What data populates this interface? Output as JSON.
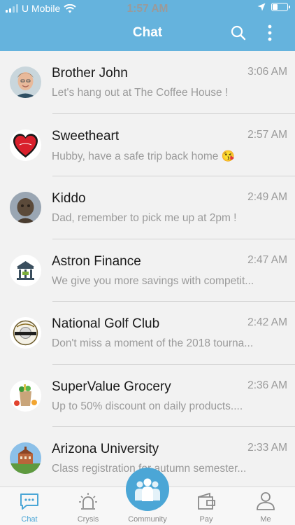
{
  "status": {
    "carrier": "U Mobile",
    "time": "1:57 AM"
  },
  "header": {
    "title": "Chat"
  },
  "chats": [
    {
      "name": "Brother John",
      "message": "Let's hang out at The Coffee House !",
      "time": "3:06 AM"
    },
    {
      "name": "Sweetheart",
      "message": "Hubby, have a safe trip back home 😘",
      "time": "2:57 AM"
    },
    {
      "name": "Kiddo",
      "message": "Dad, remember to pick me up at 2pm !",
      "time": "2:49 AM"
    },
    {
      "name": "Astron Finance",
      "message": "We give you more savings with competit...",
      "time": "2:47 AM"
    },
    {
      "name": "National Golf Club",
      "message": "Don't miss a moment of the 2018 tourna...",
      "time": "2:42 AM"
    },
    {
      "name": "SuperValue Grocery",
      "message": "Up to 50% discount on daily products....",
      "time": "2:36 AM"
    },
    {
      "name": "Arizona University",
      "message": "Class registration for autumn semester...",
      "time": "2:33 AM"
    }
  ],
  "tabs": [
    {
      "label": "Chat",
      "icon": "chat-bubble-icon"
    },
    {
      "label": "Crysis",
      "icon": "siren-icon"
    },
    {
      "label": "Community",
      "icon": "people-icon"
    },
    {
      "label": "Pay",
      "icon": "wallet-icon"
    },
    {
      "label": "Me",
      "icon": "person-icon"
    }
  ],
  "colors": {
    "header": "#65b3dd",
    "accent": "#4ba6d6",
    "muted": "#9a9a9a"
  }
}
